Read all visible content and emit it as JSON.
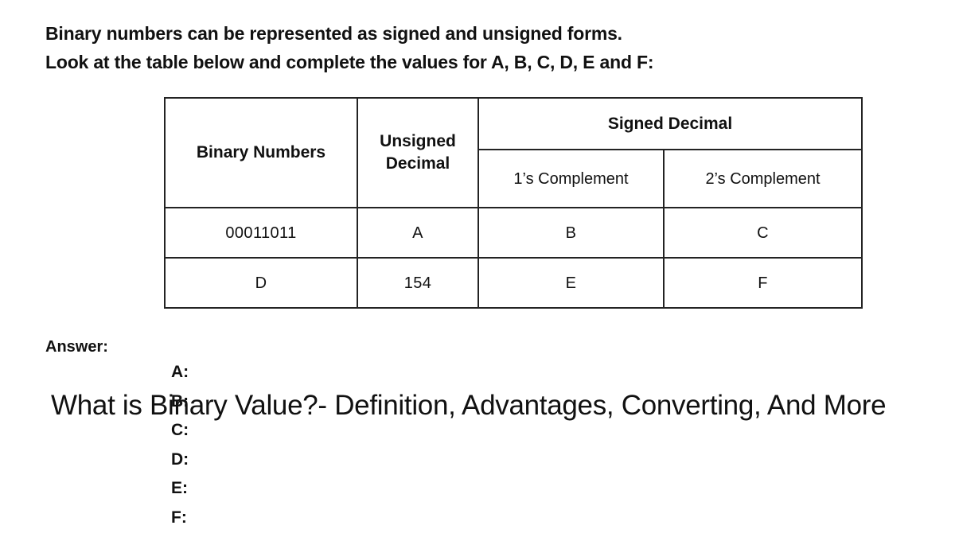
{
  "intro": {
    "line1": "Binary numbers can be represented as signed and unsigned forms.",
    "line2": "Look at the table below and complete the values for A, B, C, D, E and F:"
  },
  "table": {
    "headers": {
      "binary_numbers": "Binary Numbers",
      "unsigned_decimal": "Unsigned Decimal",
      "signed_decimal": "Signed Decimal",
      "ones_complement": "1’s Complement",
      "twos_complement": "2’s Complement"
    },
    "rows": [
      {
        "binary": "00011011",
        "unsigned": "A",
        "ones": "B",
        "twos": "C"
      },
      {
        "binary": "D",
        "unsigned": "154",
        "ones": "E",
        "twos": "F"
      }
    ]
  },
  "answer": {
    "heading": "Answer:",
    "items": [
      {
        "label": "A:"
      },
      {
        "label": "B:"
      },
      {
        "label": "C:"
      },
      {
        "label": "D:"
      },
      {
        "label": "E:"
      },
      {
        "label": "F:"
      }
    ]
  },
  "caption": {
    "text": "What is Binary Value?- Definition, Advantages, Converting, And More"
  },
  "colors": {
    "background": "#ffffff",
    "text": "#111111",
    "table_border": "#232323"
  }
}
